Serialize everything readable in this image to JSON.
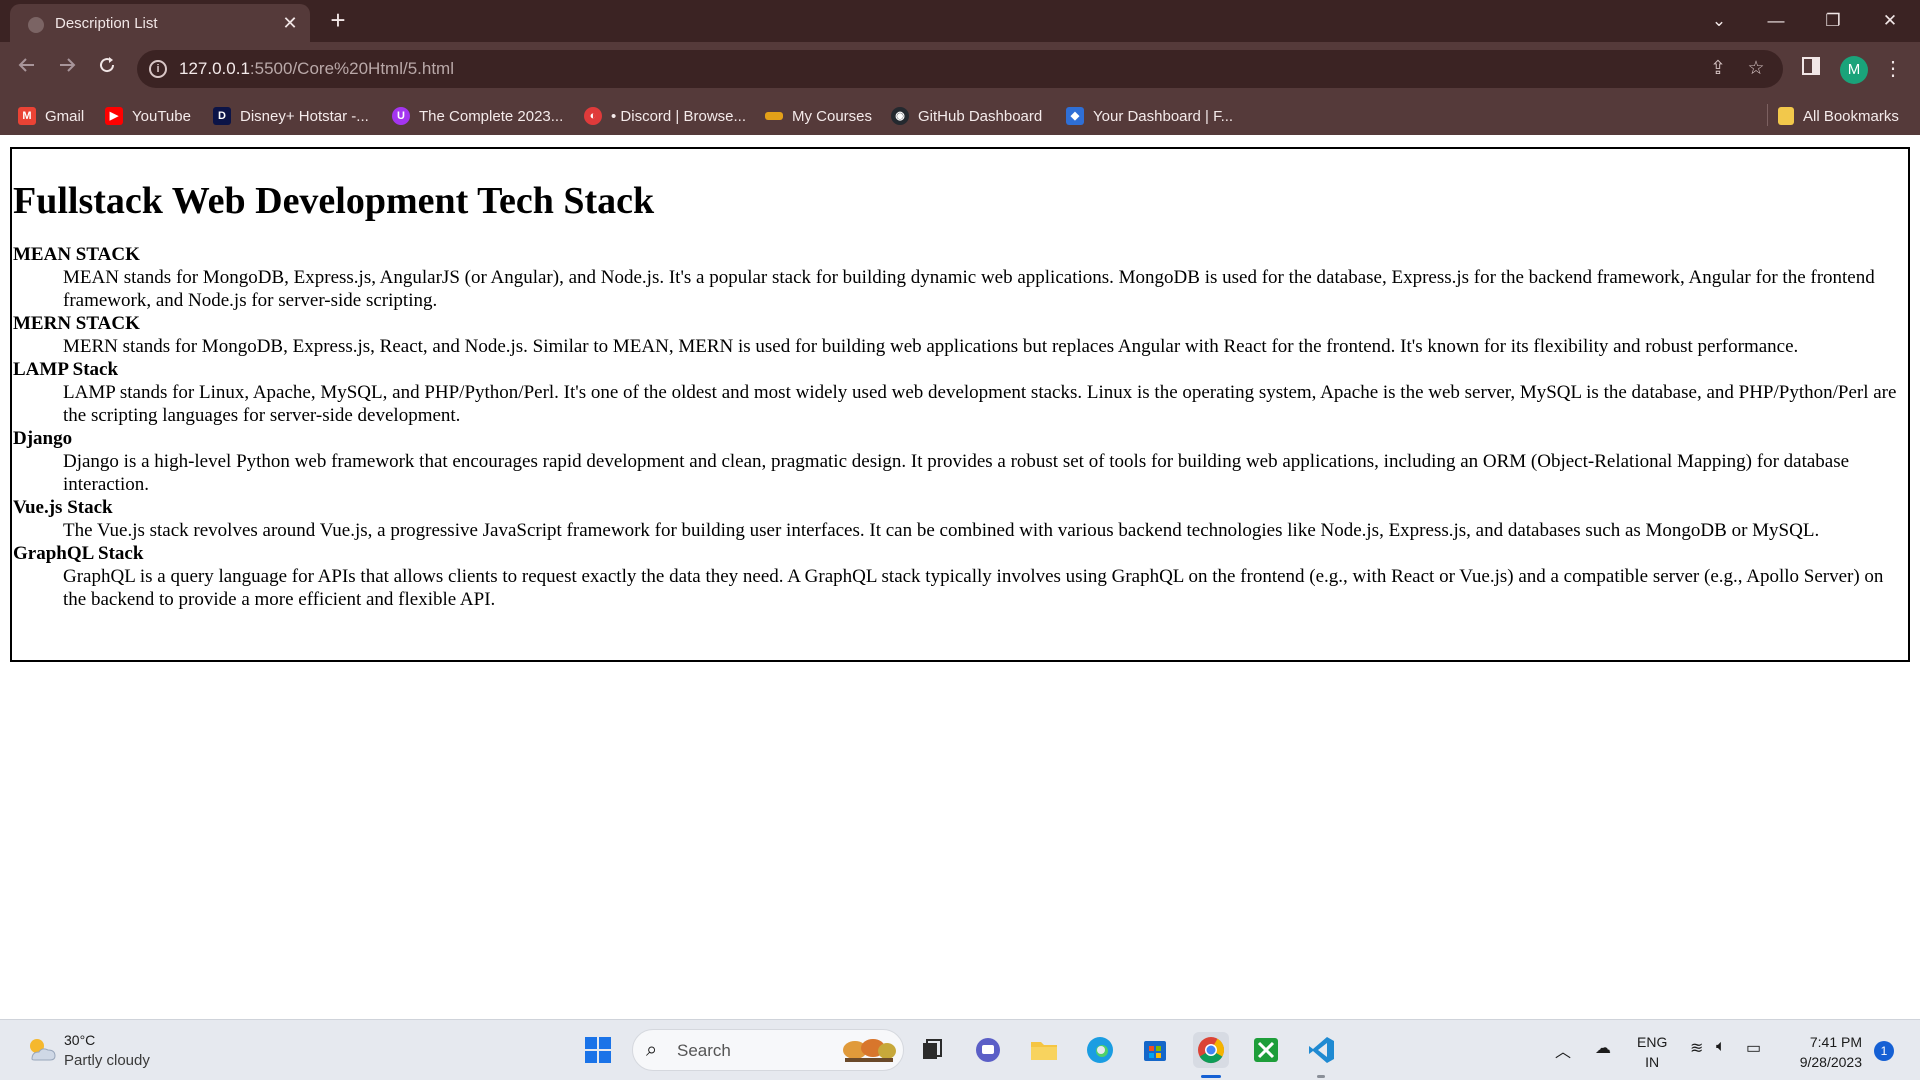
{
  "browser": {
    "tab": {
      "title": "Description List",
      "close": "✕"
    },
    "new_tab": "+",
    "window_controls": {
      "dropdown": "⌄",
      "minimize": "—",
      "restore": "❐",
      "close": "✕"
    },
    "url": {
      "host": "127.0.0.1",
      "path": ":5500/Core%20Html/5.html"
    },
    "profile_initial": "M",
    "bookmarks": [
      {
        "label": "Gmail",
        "icon": "gmail-icon",
        "color": "#ea4335"
      },
      {
        "label": "YouTube",
        "icon": "youtube-icon",
        "color": "#ff0000"
      },
      {
        "label": "Disney+ Hotstar -...",
        "icon": "hotstar-icon",
        "color": "#0c1447"
      },
      {
        "label": "The Complete 2023...",
        "icon": "udemy-icon",
        "color": "#a435f0"
      },
      {
        "label": "• Discord | Browse...",
        "icon": "discord-icon",
        "color": "#e03a3a"
      },
      {
        "label": "My Courses",
        "icon": "courses-icon",
        "color": "#e3a018"
      },
      {
        "label": "GitHub Dashboard",
        "icon": "github-icon",
        "color": "#24292f"
      },
      {
        "label": "Your Dashboard | F...",
        "icon": "dashboard-icon",
        "color": "#2f6fd6"
      }
    ],
    "all_bookmarks": "All Bookmarks"
  },
  "page": {
    "heading": "Fullstack Web Development Tech Stack",
    "items": [
      {
        "term": "MEAN STACK",
        "description": "MEAN stands for MongoDB, Express.js, AngularJS (or Angular), and Node.js. It's a popular stack for building dynamic web applications. MongoDB is used for the database, Express.js for the backend framework, Angular for the frontend framework, and Node.js for server-side scripting."
      },
      {
        "term": "MERN STACK",
        "description": "MERN stands for MongoDB, Express.js, React, and Node.js. Similar to MEAN, MERN is used for building web applications but replaces Angular with React for the frontend. It's known for its flexibility and robust performance."
      },
      {
        "term": "LAMP Stack",
        "description": "LAMP stands for Linux, Apache, MySQL, and PHP/Python/Perl. It's one of the oldest and most widely used web development stacks. Linux is the operating system, Apache is the web server, MySQL is the database, and PHP/Python/Perl are the scripting languages for server-side development."
      },
      {
        "term": "Django",
        "description": "Django is a high-level Python web framework that encourages rapid development and clean, pragmatic design. It provides a robust set of tools for building web applications, including an ORM (Object-Relational Mapping) for database interaction."
      },
      {
        "term": "Vue.js Stack",
        "description": "The Vue.js stack revolves around Vue.js, a progressive JavaScript framework for building user interfaces. It can be combined with various backend technologies like Node.js, Express.js, and databases such as MongoDB or MySQL."
      },
      {
        "term": "GraphQL Stack",
        "description": "GraphQL is a query language for APIs that allows clients to request exactly the data they need. A GraphQL stack typically involves using GraphQL on the frontend (e.g., with React or Vue.js) and a compatible server (e.g., Apollo Server) on the backend to provide a more efficient and flexible API."
      }
    ]
  },
  "taskbar": {
    "weather": {
      "temp": "30°C",
      "desc": "Partly cloudy"
    },
    "search_placeholder": "Search",
    "language": {
      "line1": "ENG",
      "line2": "IN"
    },
    "clock": {
      "time": "7:41 PM",
      "date": "9/28/2023"
    },
    "notification_count": "1"
  }
}
